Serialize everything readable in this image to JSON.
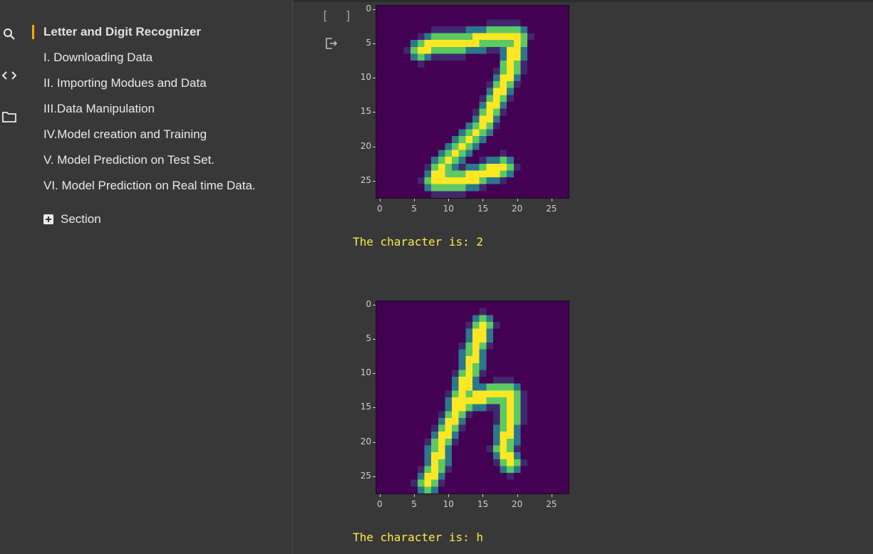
{
  "toc": {
    "title": "Letter and Digit Recognizer",
    "items": [
      "I. Downloading Data",
      "II. Importing Modues and Data",
      "III.Data Manipulation",
      "IV.Model creation and Training",
      "V. Model Prediction on Test Set.",
      "VI. Model Prediction on Real time Data."
    ],
    "add_section_label": "Section"
  },
  "cell": {
    "run_bracket": "[ ]"
  },
  "outputs": [
    {
      "text": "The character is: 2"
    },
    {
      "text": "The character is: h"
    }
  ],
  "colors": {
    "accent": "#f9ab00",
    "background": "#383838",
    "output_text": "#fdea4b",
    "viridis_low": "#440154",
    "viridis_high": "#fde725"
  },
  "icons": [
    "search-icon",
    "code-icon",
    "folder-icon",
    "output-menu-icon",
    "add-section-icon"
  ],
  "chart_data": [
    {
      "type": "heatmap",
      "title": "",
      "xlabel": "",
      "ylabel": "",
      "xlim": [
        0,
        27
      ],
      "ylim": [
        27,
        0
      ],
      "xticks": [
        "0",
        "5",
        "10",
        "15",
        "20",
        "25"
      ],
      "yticks": [
        "0",
        "5",
        "10",
        "15",
        "20",
        "25"
      ],
      "colormap": "viridis",
      "depicts": "handwritten digit 2",
      "strokes": [
        [
          [
            6,
            6
          ],
          [
            8,
            5
          ],
          [
            12,
            5
          ],
          [
            16,
            4
          ],
          [
            20,
            4
          ]
        ],
        [
          [
            20,
            4
          ],
          [
            19,
            9
          ],
          [
            17,
            13
          ],
          [
            15,
            17
          ],
          [
            12,
            20
          ],
          [
            9,
            23
          ],
          [
            8,
            25
          ]
        ],
        [
          [
            8,
            25
          ],
          [
            12,
            25
          ],
          [
            18,
            23
          ]
        ]
      ]
    },
    {
      "type": "heatmap",
      "title": "",
      "xlabel": "",
      "ylabel": "",
      "xlim": [
        0,
        27
      ],
      "ylim": [
        27,
        0
      ],
      "xticks": [
        "0",
        "5",
        "10",
        "15",
        "20",
        "25"
      ],
      "yticks": [
        "0",
        "5",
        "10",
        "15",
        "20",
        "25"
      ],
      "colormap": "viridis",
      "depicts": "handwritten letter h",
      "strokes": [
        [
          [
            15,
            3
          ],
          [
            14,
            6
          ],
          [
            13,
            10
          ],
          [
            12,
            13
          ],
          [
            11,
            16
          ],
          [
            9,
            20
          ],
          [
            8,
            24
          ],
          [
            7,
            26
          ]
        ],
        [
          [
            12,
            14
          ],
          [
            17,
            13
          ],
          [
            19,
            13
          ],
          [
            19,
            17
          ],
          [
            18,
            21
          ],
          [
            19,
            23
          ]
        ]
      ]
    }
  ]
}
